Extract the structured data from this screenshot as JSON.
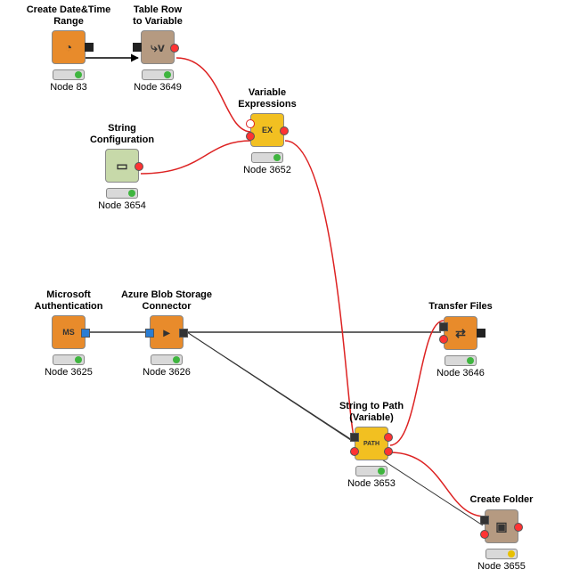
{
  "nodes": {
    "n1": {
      "title": "Create Date&Time\nRange",
      "label": "Node 83",
      "glyph": "◔",
      "bg": "#e88b2b",
      "status": "#3fb53f"
    },
    "n2": {
      "title": "Table Row\nto Variable",
      "label": "Node 3649",
      "glyph": "⤷v",
      "bg": "#b59a81",
      "status": "#3fb53f"
    },
    "n3": {
      "title": "Variable\nExpressions",
      "label": "Node 3652",
      "glyph": "EX",
      "bg": "#f2c021",
      "status": "#3fb53f"
    },
    "n4": {
      "title": "String\nConfiguration",
      "label": "Node 3654",
      "glyph": "▭",
      "bg": "#c7d9a9",
      "status": "#3fb53f"
    },
    "n5": {
      "title": "Microsoft\nAuthentication",
      "label": "Node 3625",
      "glyph": "MS",
      "bg": "#e88b2b",
      "status": "#3fb53f"
    },
    "n6": {
      "title": "Azure Blob Storage\nConnector",
      "label": "Node 3626",
      "glyph": "▸",
      "bg": "#e88b2b",
      "status": "#3fb53f"
    },
    "n7": {
      "title": "Transfer Files",
      "label": "Node 3646",
      "glyph": "⇄",
      "bg": "#e88b2b",
      "status": "#3fb53f"
    },
    "n8": {
      "title": "String to Path\n(Variable)",
      "label": "Node 3653",
      "glyph": "PATH",
      "bg": "#f2c021",
      "status": "#3fb53f"
    },
    "n9": {
      "title": "Create Folder",
      "label": "Node 3655",
      "glyph": "▣",
      "bg": "#b59a81",
      "status": "#e8c000"
    }
  }
}
